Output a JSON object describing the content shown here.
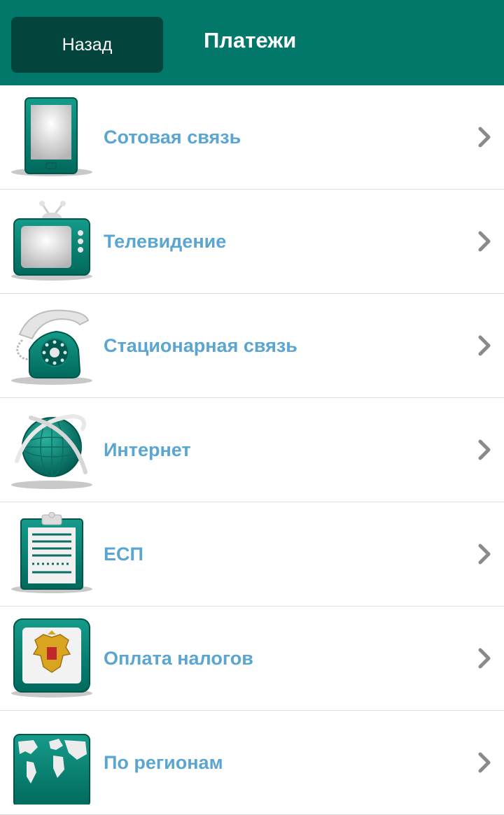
{
  "header": {
    "back_label": "Назад",
    "title": "Платежи"
  },
  "colors": {
    "header_bg": "#02786b",
    "back_btn_bg": "#03443d",
    "label": "#5aa6d0",
    "icon_green": "#00796b"
  },
  "items": [
    {
      "label": "Сотовая связь",
      "icon": "mobile-phone-icon"
    },
    {
      "label": "Телевидение",
      "icon": "tv-icon"
    },
    {
      "label": "Стационарная связь",
      "icon": "landline-phone-icon"
    },
    {
      "label": "Интернет",
      "icon": "globe-icon"
    },
    {
      "label": "ЕСП",
      "icon": "clipboard-icon"
    },
    {
      "label": "Оплата налогов",
      "icon": "coat-of-arms-icon"
    },
    {
      "label": "По регионам",
      "icon": "world-map-icon"
    }
  ]
}
